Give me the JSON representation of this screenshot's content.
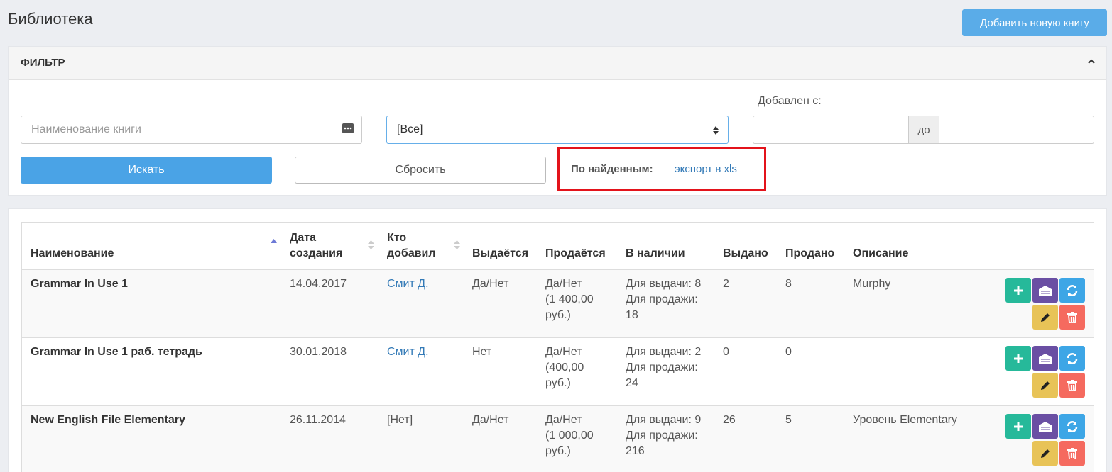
{
  "page": {
    "title": "Библиотека",
    "add_button": "Добавить новую книгу"
  },
  "filter": {
    "title": "ФИЛЬТР",
    "name_placeholder": "Наименование книги",
    "select_value": "[Все]",
    "date_label": "Добавлен с:",
    "date_separator": "до",
    "search_button": "Искать",
    "reset_button": "Сбросить",
    "export_label": "По найденным:",
    "export_link": "экспорт в xls"
  },
  "table": {
    "headers": {
      "name": "Наименование",
      "date_l1": "Дата",
      "date_l2": "создания",
      "who_l1": "Кто",
      "who_l2": "добавил",
      "issued_flag": "Выдаётся",
      "sold_flag": "Продаётся",
      "in_stock": "В наличии",
      "issued": "Выдано",
      "sold": "Продано",
      "description": "Описание"
    },
    "rows": [
      {
        "name": "Grammar In Use 1",
        "date": "14.04.2017",
        "who": "Смит Д.",
        "issued_flag": "Да/Нет",
        "sold_l1": "Да/Нет",
        "sold_l2": "(1 400,00",
        "sold_l3": "руб.)",
        "stock_l1": "Для выдачи: 8",
        "stock_l2": "Для продажи:",
        "stock_l3": "18",
        "issued": "2",
        "sold": "8",
        "description": "Murphy"
      },
      {
        "name": "Grammar In Use 1 раб. тетрадь",
        "date": "30.01.2018",
        "who": "Смит Д.",
        "issued_flag": "Нет",
        "sold_l1": "Да/Нет",
        "sold_l2": "(400,00",
        "sold_l3": "руб.)",
        "stock_l1": "Для выдачи: 2",
        "stock_l2": "Для продажи:",
        "stock_l3": "24",
        "issued": "0",
        "sold": "0",
        "description": ""
      },
      {
        "name": "New English File Elementary",
        "date": "26.11.2014",
        "who": "[Нет]",
        "issued_flag": "Да/Нет",
        "sold_l1": "Да/Нет",
        "sold_l2": "(1 000,00",
        "sold_l3": "руб.)",
        "stock_l1": "Для выдачи: 9",
        "stock_l2": "Для продажи:",
        "stock_l3": "216",
        "issued": "26",
        "sold": "5",
        "description": "Уровень Elementary"
      }
    ]
  },
  "icons": {
    "collapse": "chevron-up-icon",
    "input_dots": "dots-icon",
    "select_arrows": "sort-arrows-icon",
    "actions": [
      "plus-icon",
      "archive-icon",
      "refresh-icon",
      "pencil-icon",
      "trash-icon"
    ]
  },
  "colors": {
    "primary": "#4aa3e6",
    "add_button": "#5aace8",
    "highlight_border": "#e3131b",
    "link": "#337ab7",
    "action_plus": "#26b99a",
    "action_archive": "#6a4fa3",
    "action_refresh": "#3da6e6",
    "action_edit": "#e8c357",
    "action_delete": "#f56a5f"
  }
}
